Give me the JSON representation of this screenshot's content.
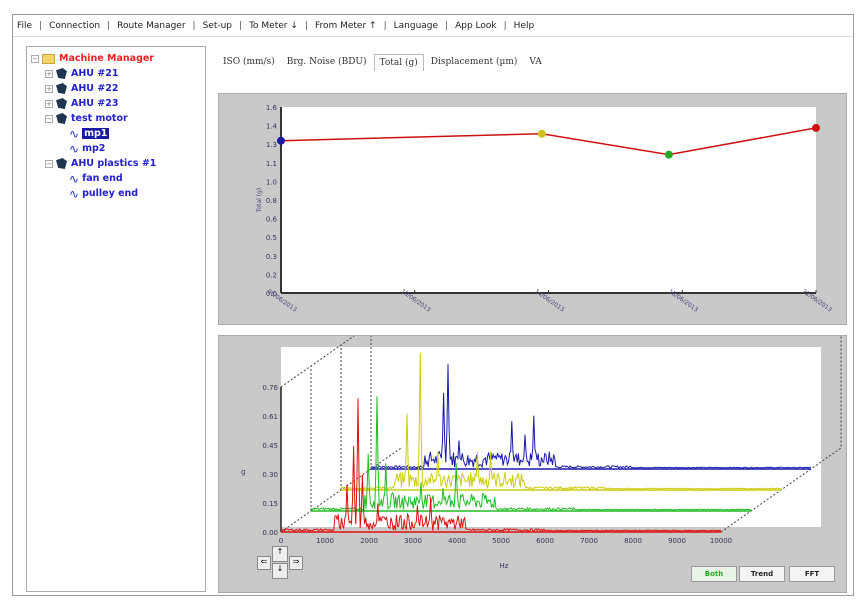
{
  "menu": [
    "File",
    "Connection",
    "Route Manager",
    "Set-up",
    "To Meter ↓",
    "From Meter ↑",
    "Language",
    "App Look",
    "Help"
  ],
  "tree": {
    "root": "Machine Manager",
    "nodes": [
      {
        "label": "AHU #21",
        "expanded": false
      },
      {
        "label": "AHU #22",
        "expanded": false
      },
      {
        "label": "AHU #23",
        "expanded": false
      },
      {
        "label": "test motor",
        "expanded": true,
        "children": [
          "mp1",
          "mp2"
        ]
      },
      {
        "label": "AHU plastics #1",
        "expanded": true,
        "children": [
          "fan end",
          "pulley end"
        ]
      }
    ],
    "selected": "mp1"
  },
  "tabs": [
    "ISO (mm/s)",
    "Brg. Noise (BDU)",
    "Total (g)",
    "Displacement (µm)",
    "VA"
  ],
  "active_tab": "Total (g)",
  "buttons": {
    "both": "Both",
    "trend": "Trend",
    "fft": "FFT"
  },
  "nav": {
    "up": "↑",
    "down": "↓",
    "left": "⇐",
    "right": "⇒"
  },
  "colors": {
    "red": "#dd1111",
    "blue": "#1a1aaa",
    "yellow": "#dddd22",
    "green": "#22bb22"
  },
  "chart_data": [
    {
      "type": "line",
      "ylabel": "Total (g)",
      "ylim": [
        0,
        1.6
      ],
      "yticks": [
        "0.0",
        "0.2",
        "0.3",
        "0.5",
        "0.6",
        "0.8",
        "1.0",
        "1.1",
        "1.3",
        "1.4",
        "1.6"
      ],
      "xticks": [
        "06/06/2013",
        "10/06/2013",
        "14/06/2013",
        "18/06/2013",
        "22/06/2013"
      ],
      "points": [
        {
          "day": 0,
          "y": 1.31,
          "color": "#1a1aaa"
        },
        {
          "day": 7.8,
          "y": 1.37,
          "color": "#d4c020"
        },
        {
          "day": 11.6,
          "y": 1.19,
          "color": "#22aa22"
        },
        {
          "day": 16,
          "y": 1.42,
          "color": "#cc1111"
        }
      ]
    },
    {
      "type": "line",
      "xlabel": "Hz",
      "ylabel": "g",
      "xlim": [
        0,
        10000
      ],
      "ylim": [
        0,
        0.76
      ],
      "xticks": [
        "0",
        "1000",
        "2000",
        "3000",
        "4000",
        "5000",
        "6000",
        "7000",
        "8000",
        "9000",
        "10000"
      ],
      "yticks": [
        "0.00",
        "0.15",
        "0.30",
        "0.45",
        "0.61",
        "0.76"
      ],
      "series": [
        {
          "color": "#dd1111",
          "peaks": [
            [
              1750,
              0.7
            ],
            [
              1650,
              0.45
            ],
            [
              1850,
              0.3
            ],
            [
              1500,
              0.25
            ],
            [
              2200,
              0.15
            ],
            [
              3400,
              0.18
            ],
            [
              3100,
              0.14
            ],
            [
              2700,
              0.08
            ],
            [
              3900,
              0.05
            ]
          ]
        },
        {
          "color": "#22bb22",
          "peaks": [
            [
              1500,
              0.6
            ],
            [
              1300,
              0.3
            ],
            [
              1700,
              0.25
            ],
            [
              3300,
              0.25
            ],
            [
              2500,
              0.15
            ],
            [
              3000,
              0.12
            ]
          ]
        },
        {
          "color": "#cccc11",
          "peaks": [
            [
              1800,
              0.72
            ],
            [
              1500,
              0.4
            ],
            [
              3100,
              0.2
            ],
            [
              3400,
              0.2
            ],
            [
              2200,
              0.2
            ]
          ]
        },
        {
          "color": "#1a1aaa",
          "peaks": [
            [
              1750,
              0.55
            ],
            [
              1650,
              0.4
            ],
            [
              3200,
              0.25
            ],
            [
              3700,
              0.28
            ],
            [
              2000,
              0.15
            ],
            [
              3500,
              0.18
            ]
          ]
        }
      ]
    }
  ]
}
